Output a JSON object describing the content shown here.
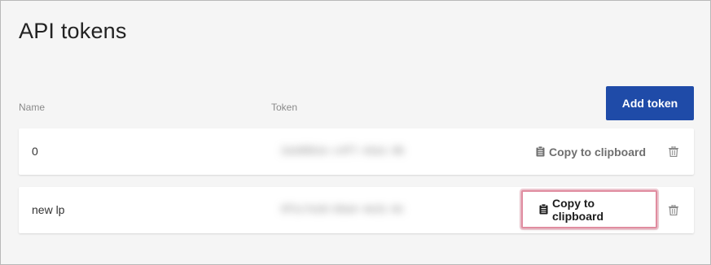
{
  "page": {
    "title": "API tokens"
  },
  "table": {
    "columns": {
      "name": "Name",
      "token": "Token"
    },
    "add_button_label": "Add token",
    "rows": [
      {
        "name": "0",
        "token": "2a3d5b1e-c4f7-42a1-9b",
        "copy_label": "Copy to clipboard",
        "copy_icon": "clipboard-icon",
        "delete_icon": "trash-icon"
      },
      {
        "name": "new lp",
        "token": "9f1c7e2d-b5a4-4e31-8c",
        "copy_label": "Copy to clipboard",
        "copy_icon": "clipboard-icon",
        "delete_icon": "trash-icon",
        "highlighted": true
      }
    ]
  },
  "colors": {
    "accent": "#1f4ba8",
    "highlight_border": "#e08ca0",
    "background": "#f5f5f5"
  }
}
